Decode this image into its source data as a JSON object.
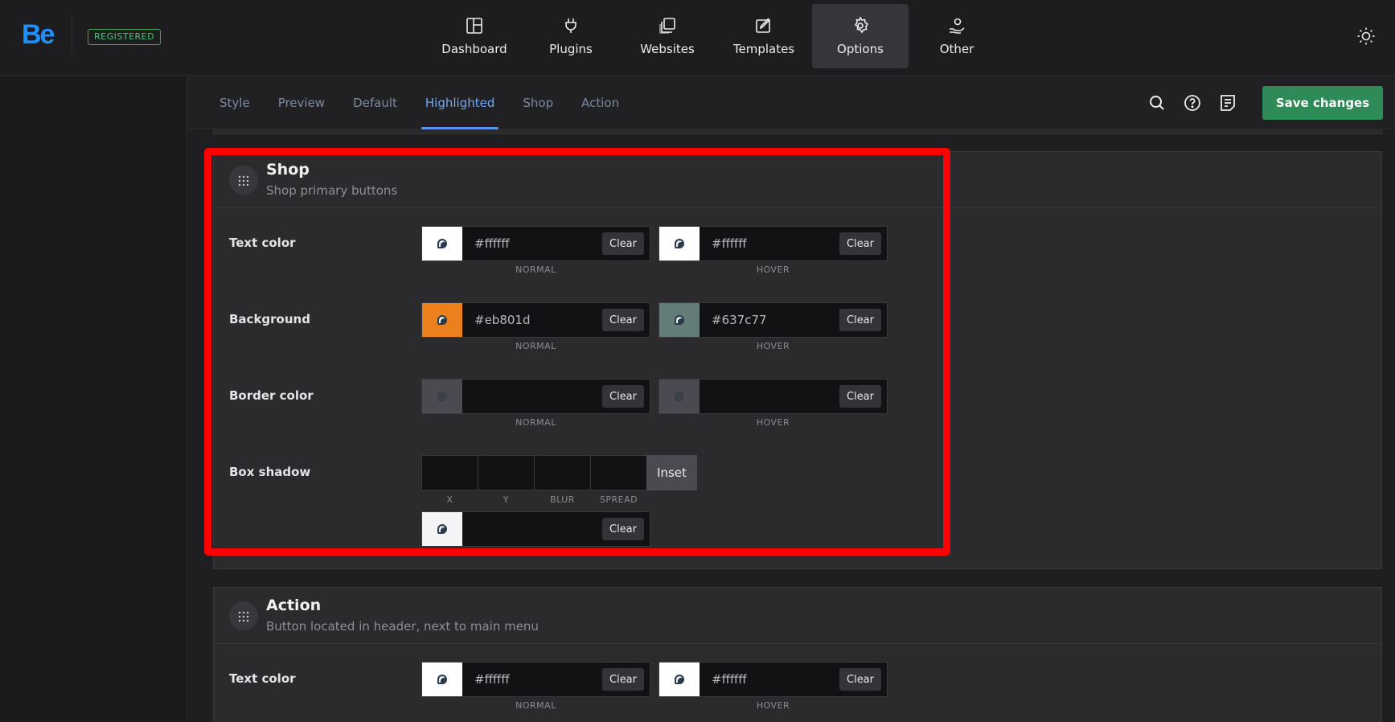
{
  "app": {
    "logo_text": "Be",
    "badge": "REGISTERED"
  },
  "topnav": [
    {
      "label": "Dashboard",
      "icon": "dashboard-icon"
    },
    {
      "label": "Plugins",
      "icon": "plug-icon"
    },
    {
      "label": "Websites",
      "icon": "websites-icon"
    },
    {
      "label": "Templates",
      "icon": "templates-icon"
    },
    {
      "label": "Options",
      "icon": "gear-icon",
      "active": true
    },
    {
      "label": "Other",
      "icon": "hand-user-icon"
    }
  ],
  "tabs": [
    {
      "label": "Style"
    },
    {
      "label": "Preview"
    },
    {
      "label": "Default"
    },
    {
      "label": "Highlighted",
      "active": true
    },
    {
      "label": "Shop"
    },
    {
      "label": "Action"
    }
  ],
  "toolbar": {
    "save_label": "Save changes"
  },
  "shop": {
    "title": "Shop",
    "subtitle": "Shop primary buttons",
    "text_color": {
      "label": "Text color",
      "normal": "#ffffff",
      "hover": "#ffffff",
      "normal_swatch": "#ffffff",
      "hover_swatch": "#ffffff"
    },
    "background": {
      "label": "Background",
      "normal": "#eb801d",
      "hover": "#637c77",
      "normal_swatch": "#eb801d",
      "hover_swatch": "#637c77"
    },
    "border_color": {
      "label": "Border color",
      "normal": "",
      "hover": ""
    },
    "box_shadow": {
      "label": "Box shadow",
      "inset": "Inset",
      "x": "X",
      "y": "Y",
      "blur": "BLUR",
      "spread": "SPREAD"
    }
  },
  "action": {
    "title": "Action",
    "subtitle": "Button located in header, next to main menu",
    "text_color": {
      "label": "Text color",
      "normal": "#ffffff",
      "hover": "#ffffff"
    }
  },
  "common": {
    "clear": "Clear",
    "normal": "NORMAL",
    "hover": "HOVER"
  },
  "colors": {
    "accent": "#1e8fff",
    "save": "#2e8a56",
    "highlight": "#ff0000",
    "active_tab": "#6fa8f5"
  }
}
